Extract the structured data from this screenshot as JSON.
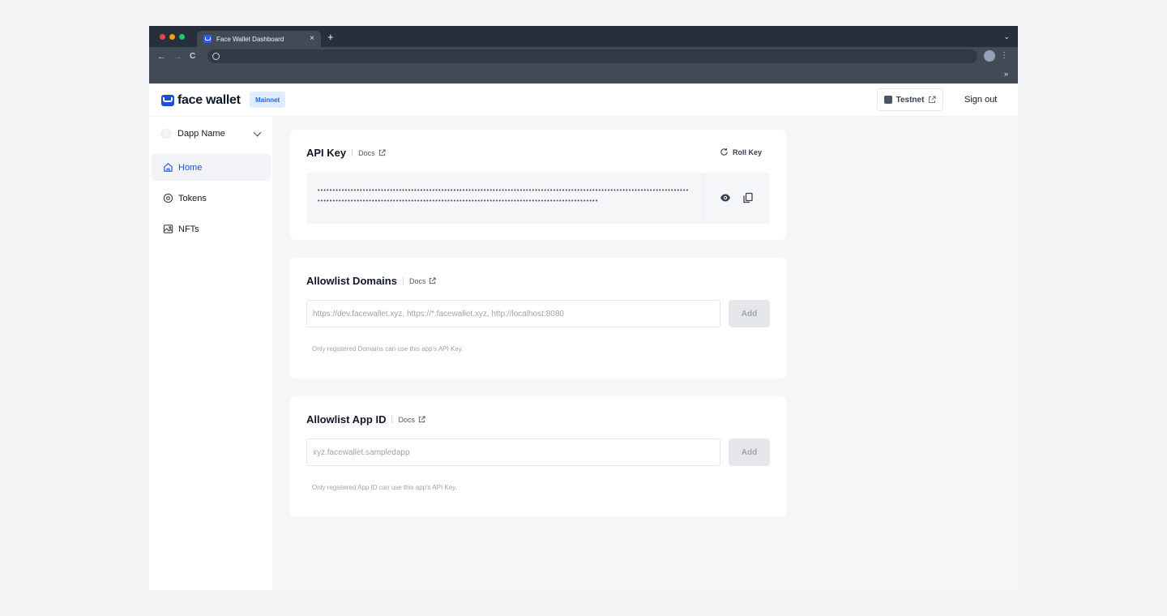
{
  "browser": {
    "tab_title": "Face Wallet Dashboard",
    "tab_close": "×",
    "new_tab": "+",
    "tabs_chevron": "⌄",
    "back": "←",
    "forward": "→",
    "reload": "C",
    "kebab": "⋮",
    "bookmarks_more": "»",
    "traffic_colors": [
      "#ef4444",
      "#f59e0b",
      "#22c55e"
    ]
  },
  "header": {
    "logo_text": "face wallet",
    "network_badge": "Mainnet",
    "testnet_label": "Testnet",
    "signout_label": "Sign out",
    "brand_color": "#1d4ed8"
  },
  "sidebar": {
    "dapp_name": "Dapp Name",
    "items": [
      {
        "label": "Home",
        "icon": "home-icon",
        "active": true
      },
      {
        "label": "Tokens",
        "icon": "token-icon",
        "active": false
      },
      {
        "label": "NFTs",
        "icon": "image-icon",
        "active": false
      }
    ]
  },
  "api_key": {
    "title": "API Key",
    "docs_label": "Docs",
    "roll_label": "Roll Key",
    "masked_value": "••••••••••••••••••••••••••••••••••••••••••••••••••••••••••••••••••••••••••••••••••••••••••••••••••••••••••••••••••••••••••••••••••••••••••••••••••••••••••••••••••••••••••••••••••••••••••••••••••••••••••••••••••••••••"
  },
  "allowlist_domains": {
    "title": "Allowlist Domains",
    "docs_label": "Docs",
    "placeholder": "https://dev.facewallet.xyz, https://*.facewallet.xyz, http://localhost:8080",
    "add_label": "Add",
    "help": "Only registered Domains can use this app's API Key."
  },
  "allowlist_app_id": {
    "title": "Allowlist App ID",
    "docs_label": "Docs",
    "placeholder": "xyz.facewallet.sampledapp",
    "add_label": "Add",
    "help": "Only registered App ID can use this app's API Key."
  }
}
